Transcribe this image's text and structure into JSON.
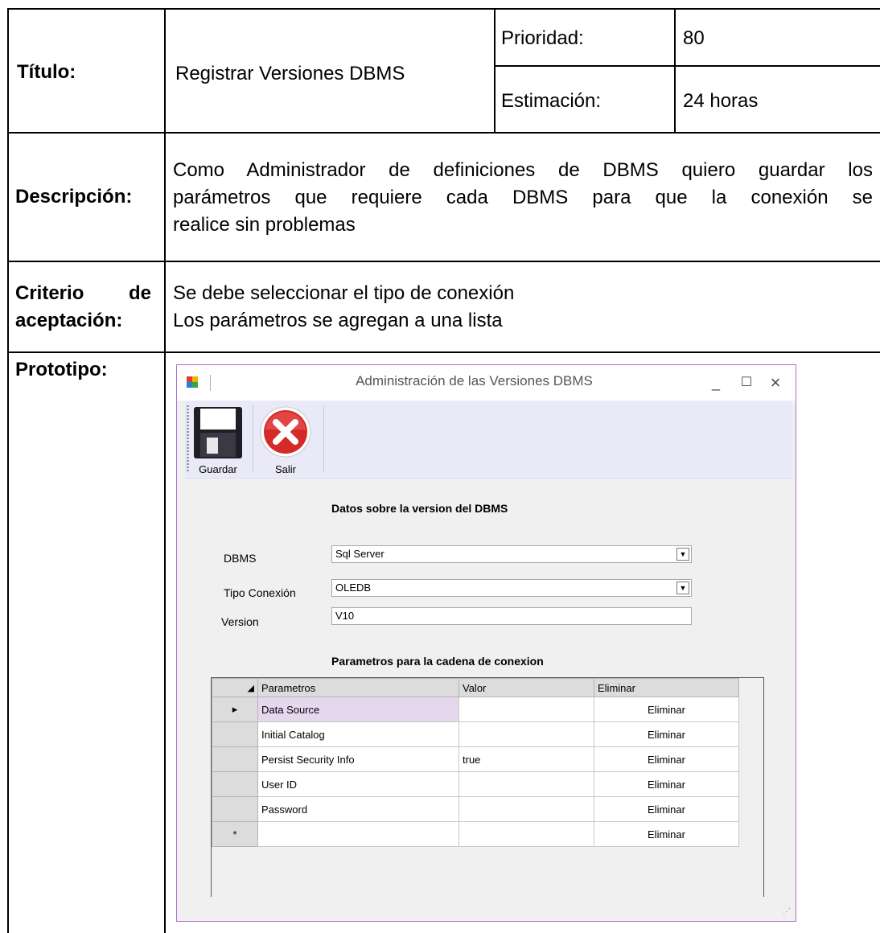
{
  "doc": {
    "titulo_label": "Título:",
    "titulo_value": "Registrar Versiones DBMS",
    "prioridad_label": "Prioridad:",
    "prioridad_value": "80",
    "estimacion_label": "Estimación:",
    "estimacion_value": "24 horas",
    "descripcion_label": "Descripción:",
    "descripcion_lines": [
      "Como Administrador de definiciones de DBMS quiero guardar los",
      "parámetros que requiere cada DBMS para que la conexión se",
      "realice sin problemas"
    ],
    "criterio_label_1": "Criterio",
    "criterio_label_de": "de",
    "criterio_label_2": "aceptación:",
    "criterio_lines": [
      "Se debe seleccionar el tipo de conexión",
      "Los parámetros se agregan a una lista"
    ],
    "prototipo_label": "Prototipo:"
  },
  "window": {
    "title": "Administración de las Versiones DBMS",
    "minimize": "_",
    "maximize": "☐",
    "close": "×",
    "toolbar": {
      "guardar_label": "Guardar",
      "guardar_icon": "floppy-disk-icon",
      "salir_label": "Salir",
      "salir_icon": "red-x-circle-icon"
    },
    "section_title": "Datos sobre la version del DBMS",
    "dbms_label": "DBMS",
    "dbms_value": "Sql Server",
    "tipo_label": "Tipo Conexión",
    "tipo_value": "OLEDB",
    "version_label": "Version",
    "version_value": "V10",
    "params_title": "Parametros para la cadena de conexion",
    "grid": {
      "headers": [
        "Parametros",
        "Valor",
        "Eliminar"
      ],
      "rows": [
        {
          "marker": "▸",
          "param": "Data Source",
          "valor": "",
          "action": "Eliminar"
        },
        {
          "marker": "",
          "param": "Initial Catalog",
          "valor": "",
          "action": "Eliminar"
        },
        {
          "marker": "",
          "param": "Persist Security Info",
          "valor": "true",
          "action": "Eliminar"
        },
        {
          "marker": "",
          "param": "User ID",
          "valor": "",
          "action": "Eliminar"
        },
        {
          "marker": "",
          "param": "Password",
          "valor": "",
          "action": "Eliminar"
        },
        {
          "marker": "*",
          "param": "",
          "valor": "",
          "action": "Eliminar"
        }
      ]
    },
    "colors": {
      "accent_border": "#a86fd0",
      "toolbar_bg": "#e9e9f7",
      "selected_cell": "#e6d7ef"
    }
  }
}
